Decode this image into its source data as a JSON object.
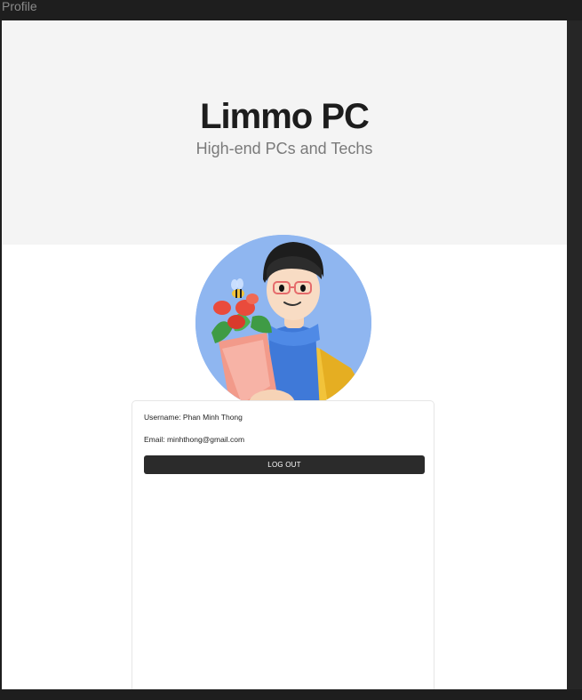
{
  "window": {
    "frame_label": "Profile"
  },
  "hero": {
    "title": "Limmo PC",
    "subtitle": "High-end PCs and Techs"
  },
  "profile": {
    "username_line": "Username: Phan Minh Thong",
    "email_line": "Email: minhthong@gmail.com",
    "logout_label": "LOG OUT",
    "avatar_icon": "avatar-illustration"
  },
  "colors": {
    "background_dark": "#1e1e1e",
    "hero_bg": "#f4f4f4",
    "button_bg": "#2b2b2b",
    "avatar_bg": "#8fb6f0"
  }
}
